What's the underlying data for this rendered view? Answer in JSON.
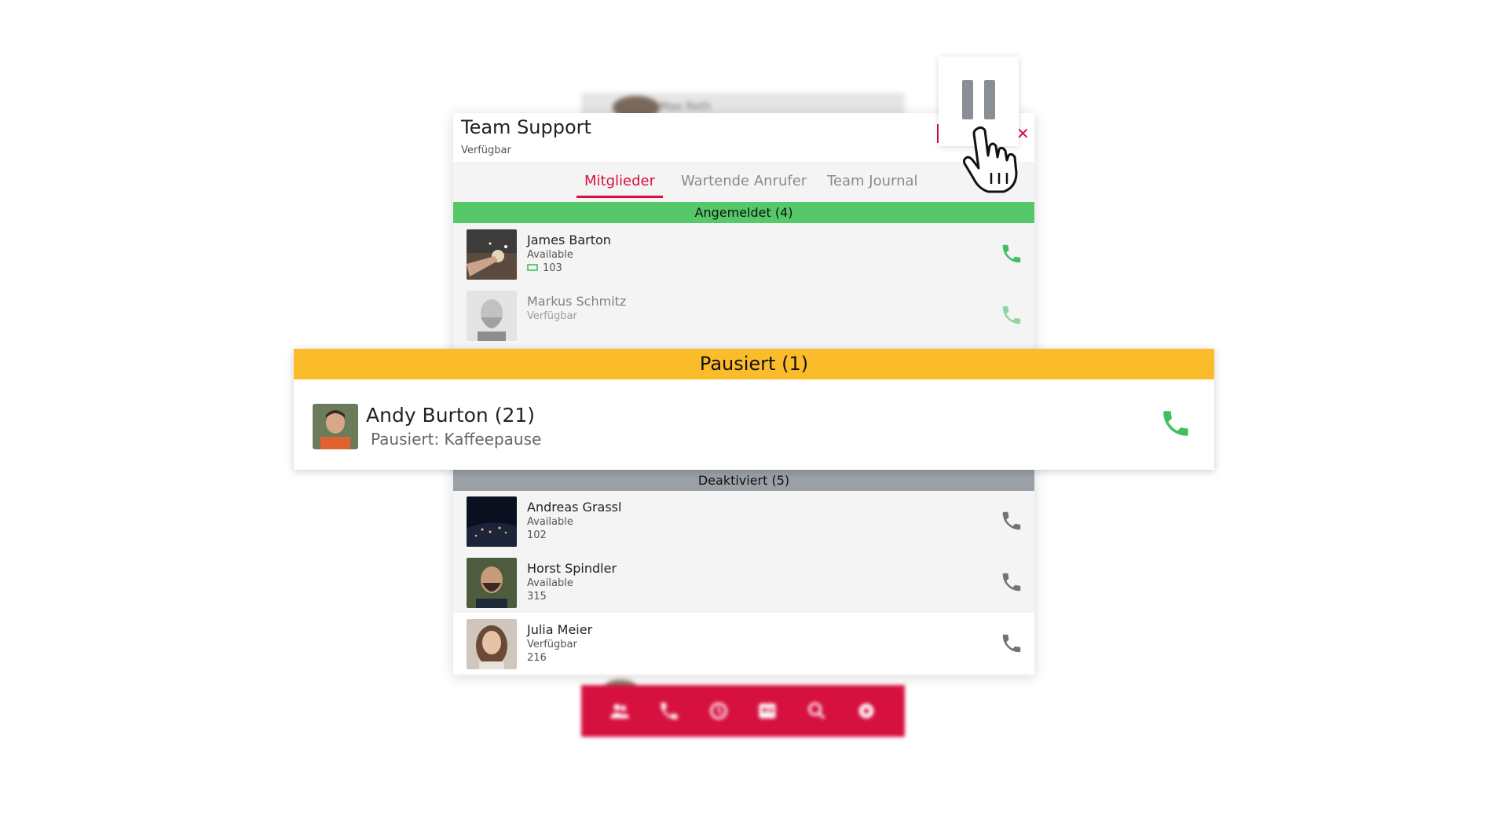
{
  "team": {
    "title": "Team Support",
    "status": "Verfügbar"
  },
  "tabs": [
    {
      "label": "Mitglieder",
      "active": true
    },
    {
      "label": "Wartende Anrufer",
      "active": false
    },
    {
      "label": "Team Journal",
      "active": false
    }
  ],
  "sections": {
    "logged_in": "Angemeldet (4)",
    "paused": "Pausiert (1)",
    "deactivated": "Deaktiviert (5)"
  },
  "logged_in_members": [
    {
      "name": "James Barton",
      "status": "Available",
      "extension": "103"
    },
    {
      "name": "Markus Schmitz",
      "status": "Verfügbar"
    }
  ],
  "paused_member": {
    "name": "Andy Burton (21)",
    "status": "Pausiert: Kaffeepause"
  },
  "deactivated_members": [
    {
      "name": "Andreas Grassl",
      "status": "Available",
      "extension": "102"
    },
    {
      "name": "Horst Spindler",
      "status": "Available",
      "extension": "315"
    },
    {
      "name": "Julia Meier",
      "status": "Verfügbar",
      "extension": "216"
    }
  ],
  "background": {
    "header_name": "Max Roth"
  },
  "bottom_nav": {
    "icons": [
      "team-icon",
      "phone-icon",
      "history-icon",
      "contacts-icon",
      "search-icon",
      "settings-icon"
    ]
  },
  "colors": {
    "accent": "#d6103f",
    "online": "#55c96a",
    "paused": "#fbbc2c",
    "deactivated": "#9aa0a6",
    "phone_active": "#3fbf5f",
    "phone_inactive": "#6f747a"
  }
}
